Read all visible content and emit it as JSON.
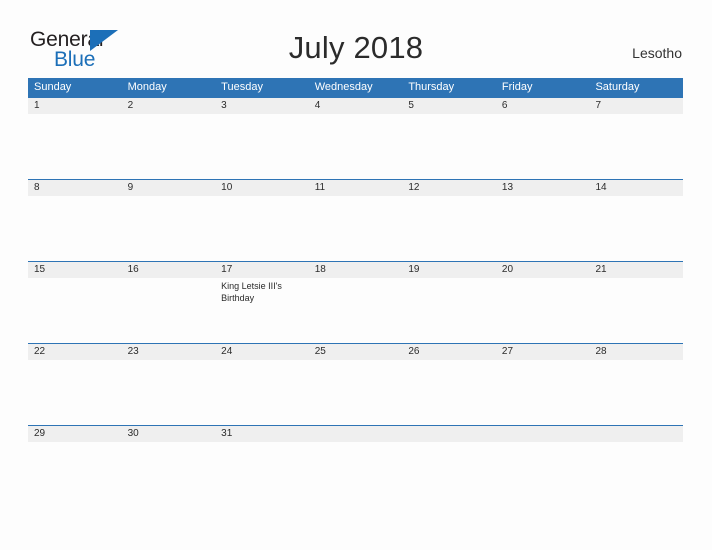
{
  "brand": {
    "word_one": "General",
    "word_two": "Blue",
    "logo_icon": "blue-triangle-flag-icon",
    "accent_color": "#1c6fb8"
  },
  "header": {
    "title": "July 2018",
    "country": "Lesotho"
  },
  "theme": {
    "header_blue": "#2e74b5",
    "date_band_gray": "#efefef",
    "page_background": "#fdfdfd",
    "text_color": "#2b2b2b"
  },
  "calendar": {
    "daynames": [
      "Sunday",
      "Monday",
      "Tuesday",
      "Wednesday",
      "Thursday",
      "Friday",
      "Saturday"
    ],
    "weeks": [
      {
        "dates": [
          "1",
          "2",
          "3",
          "4",
          "5",
          "6",
          "7"
        ],
        "events": [
          "",
          "",
          "",
          "",
          "",
          "",
          ""
        ]
      },
      {
        "dates": [
          "8",
          "9",
          "10",
          "11",
          "12",
          "13",
          "14"
        ],
        "events": [
          "",
          "",
          "",
          "",
          "",
          "",
          ""
        ]
      },
      {
        "dates": [
          "15",
          "16",
          "17",
          "18",
          "19",
          "20",
          "21"
        ],
        "events": [
          "",
          "",
          "King Letsie III's Birthday",
          "",
          "",
          "",
          ""
        ]
      },
      {
        "dates": [
          "22",
          "23",
          "24",
          "25",
          "26",
          "27",
          "28"
        ],
        "events": [
          "",
          "",
          "",
          "",
          "",
          "",
          ""
        ]
      },
      {
        "dates": [
          "29",
          "30",
          "31",
          "",
          "",
          "",
          ""
        ],
        "events": [
          "",
          "",
          "",
          "",
          "",
          "",
          ""
        ]
      }
    ]
  }
}
